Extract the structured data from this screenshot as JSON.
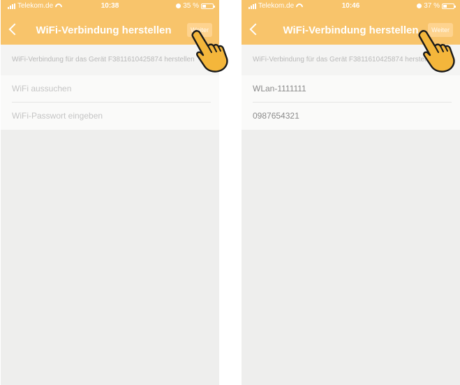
{
  "colors": {
    "topbar": "#f8c46b",
    "screen_bg": "#eeeeed",
    "hand_fill": "#f4b63b",
    "hand_outline": "#1a1a1a"
  },
  "left_screen": {
    "status": {
      "carrier": "Telekom.de",
      "time": "10:38",
      "battery": "35 %",
      "battery_level": 0.35
    },
    "nav": {
      "title": "WiFi-Verbindung herstellen",
      "action_label": "Weiter"
    },
    "info_text": "WiFi-Verbindung für das Gerät F3811610425874 herstellen",
    "fields": [
      {
        "placeholder": "WiFi aussuchen",
        "value": ""
      },
      {
        "placeholder": "WiFi-Passwort eingeben",
        "value": ""
      }
    ]
  },
  "right_screen": {
    "status": {
      "carrier": "Telekom.de",
      "time": "10:46",
      "battery": "37 %",
      "battery_level": 0.37
    },
    "nav": {
      "title": "WiFi-Verbindung herstellen",
      "action_label": "Weiter"
    },
    "info_text": "WiFi-Verbindung für das Gerät F3811610425874 herstellen",
    "fields": [
      {
        "placeholder": "WiFi aussuchen",
        "value": "WLan-1111111"
      },
      {
        "placeholder": "WiFi-Passwort eingeben",
        "value": "0987654321"
      }
    ]
  },
  "icons": [
    "signal-icon",
    "wifi-icon",
    "alarm-icon",
    "battery-icon",
    "back-chevron-icon",
    "pointing-hand-icon"
  ]
}
